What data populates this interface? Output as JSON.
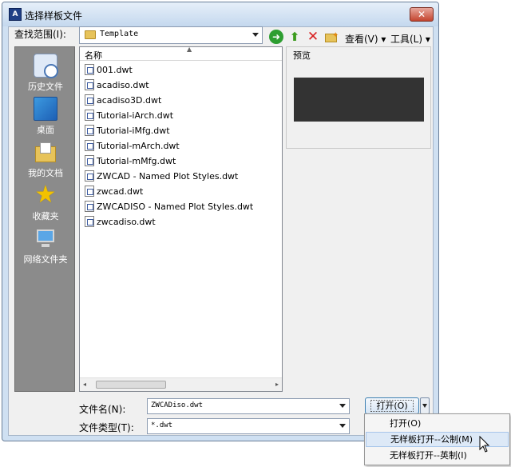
{
  "window": {
    "title": "选择样板文件",
    "icon_text": "A",
    "close_label": "✕"
  },
  "lookin": {
    "label": "查找范围(I):",
    "value": "Template"
  },
  "toolbar": {
    "back_glyph": "➜",
    "up_glyph": "⬆",
    "delete_glyph": "✕",
    "new_folder_glyph": "✦",
    "view_menu": "查看(V) ▾",
    "tools_menu": "工具(L) ▾"
  },
  "places": [
    {
      "label": "历史文件",
      "icon": "history-icon"
    },
    {
      "label": "桌面",
      "icon": "desktop-icon"
    },
    {
      "label": "我的文档",
      "icon": "my-documents-icon"
    },
    {
      "label": "收藏夹",
      "icon": "favorites-icon"
    },
    {
      "label": "网络文件夹",
      "icon": "network-folder-icon"
    }
  ],
  "filelist": {
    "column_name": "名称",
    "sort_glyph": "▲",
    "files": [
      "001.dwt",
      "acadiso.dwt",
      "acadiso3D.dwt",
      "Tutorial-iArch.dwt",
      "Tutorial-iMfg.dwt",
      "Tutorial-mArch.dwt",
      "Tutorial-mMfg.dwt",
      "ZWCAD - Named Plot Styles.dwt",
      "zwcad.dwt",
      "ZWCADISO - Named Plot Styles.dwt",
      "zwcadiso.dwt"
    ],
    "scroll_left": "◂",
    "scroll_right": "▸"
  },
  "preview": {
    "label": "预览",
    "box_color": "#333333"
  },
  "filename": {
    "label": "文件名(N):",
    "value": "ZWCADiso.dwt"
  },
  "filetype": {
    "label": "文件类型(T):",
    "value": "*.dwt"
  },
  "open_button": {
    "label": "打开(O)"
  },
  "dropdown_menu": {
    "items": [
      "打开(O)",
      "无样板打开--公制(M)",
      "无样板打开--英制(I)"
    ],
    "hovered_index": 1
  }
}
